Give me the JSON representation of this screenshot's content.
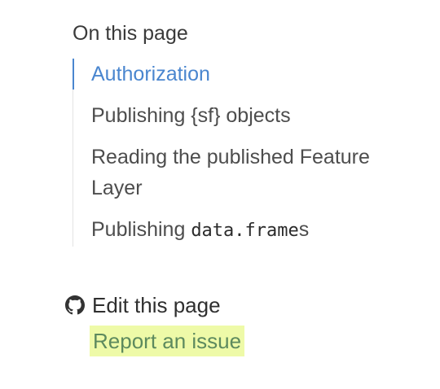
{
  "toc": {
    "heading": "On this page",
    "items": [
      {
        "label": "Authorization"
      },
      {
        "label": "Publishing {sf} objects"
      },
      {
        "label": "Reading the published Feature Layer"
      },
      {
        "prefix": "Publishing ",
        "code": "data.frame",
        "suffix": "s"
      }
    ]
  },
  "links": {
    "edit": {
      "label": "Edit this page",
      "icon": "github-icon"
    },
    "report": {
      "label": "Report an issue"
    }
  },
  "colors": {
    "active": "#4a86cf",
    "highlight": "#eefaa8",
    "report_text": "#5d8a5e"
  }
}
